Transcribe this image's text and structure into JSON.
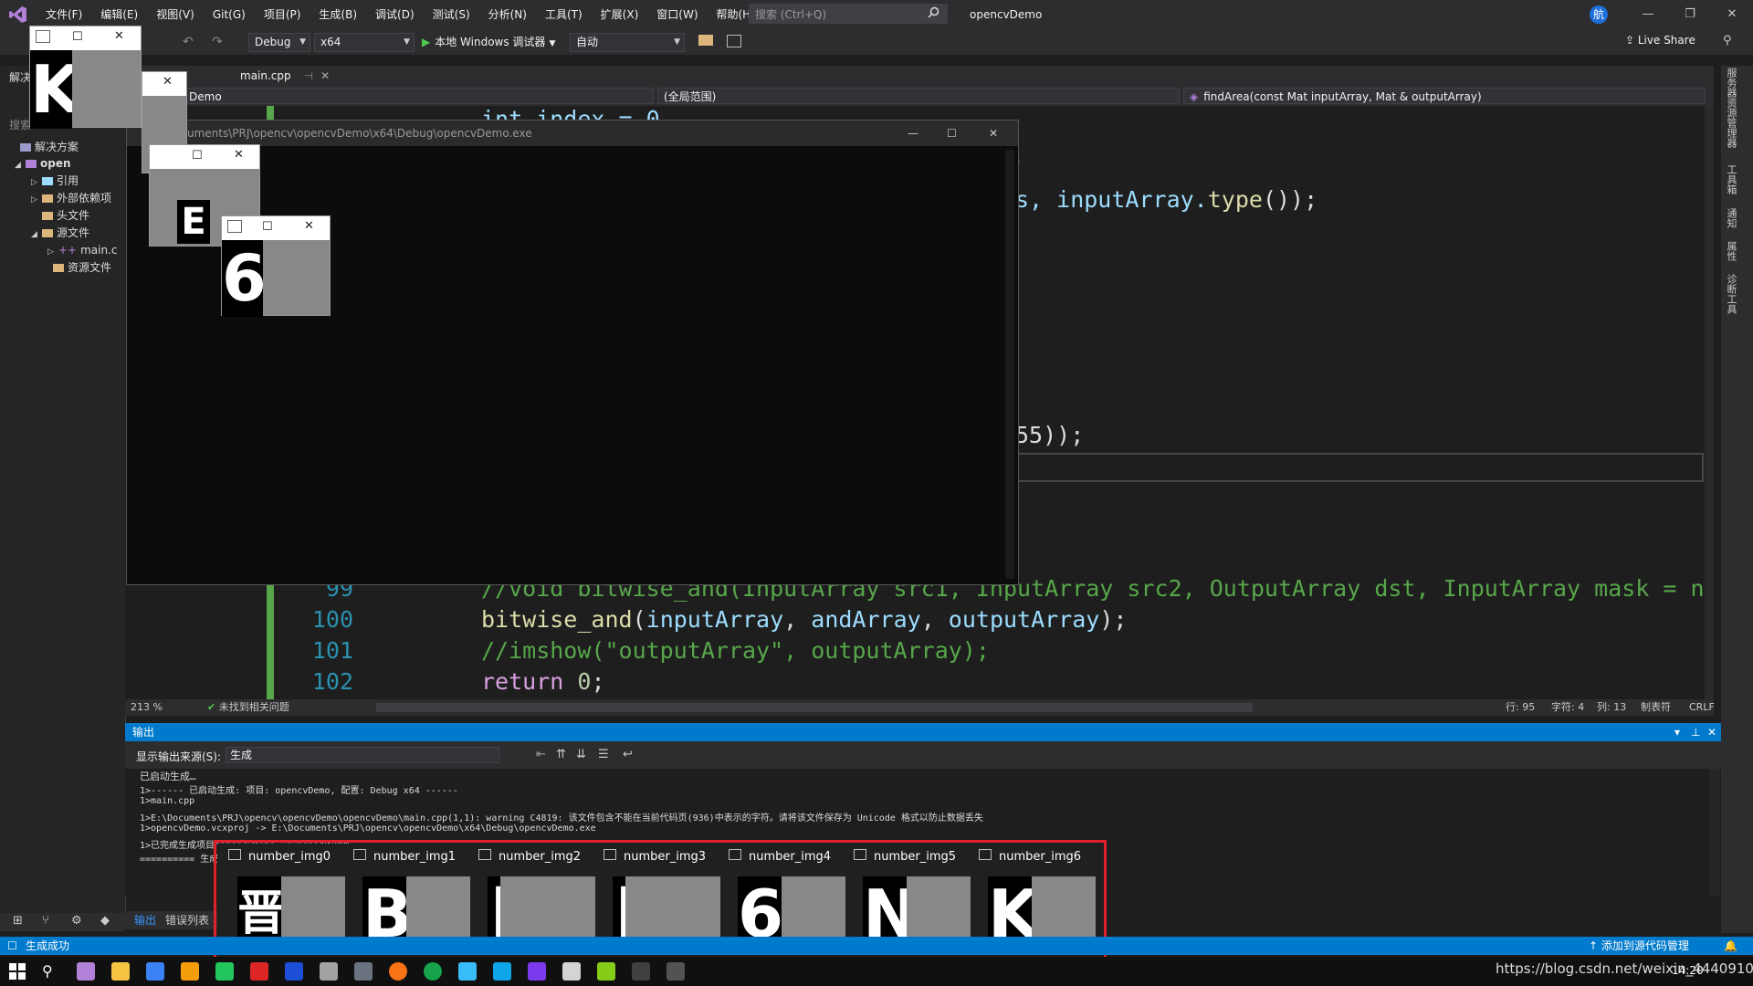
{
  "menu": {
    "items": [
      "文件(F)",
      "编辑(E)",
      "视图(V)",
      "Git(G)",
      "项目(P)",
      "生成(B)",
      "调试(D)",
      "测试(S)",
      "分析(N)",
      "工具(T)",
      "扩展(X)",
      "窗口(W)",
      "帮助(H)"
    ],
    "search_placeholder": "搜索 (Ctrl+Q)",
    "solution_name": "opencvDemo",
    "account_initial": "航"
  },
  "toolbar": {
    "config": "Debug",
    "platform": "x64",
    "run_label": "本地 Windows 调试器",
    "auto": "自动",
    "live_share": "Live Share"
  },
  "solution_explorer": {
    "title": "解决",
    "search": "搜索",
    "items": [
      {
        "label": "解决方案"
      },
      {
        "label": "open"
      },
      {
        "label": "引用"
      },
      {
        "label": "外部依赖项"
      },
      {
        "label": "头文件"
      },
      {
        "label": "源文件"
      },
      {
        "label": "main.c"
      },
      {
        "label": "资源文件"
      }
    ]
  },
  "editor": {
    "tab": "main.cpp",
    "project_scope": "Demo",
    "scope": "(全局范围)",
    "function_scope": "findArea(const Mat inputArray, Mat & outputArray)",
    "fragments": {
      "top_partial": "int index = 0",
      "semicolon": ";",
      "type_line_prefix": "s, inputArray.",
      "type_fn": "type",
      "type_line_suffix": "());",
      "num_line": "55));"
    },
    "lines": [
      {
        "no": "99",
        "comment": "//void bitwise_and(InputArray src1, InputArray src2, OutputArray dst, InputArray mask = noArray());"
      },
      {
        "no": "100",
        "fn": "bitwise_and",
        "args1": "inputArray",
        "args2": "andArray",
        "args3": "outputArray"
      },
      {
        "no": "101",
        "comment": "//imshow(\"outputArray\", outputArray);"
      },
      {
        "no": "102",
        "kw": "return",
        "num": "0"
      }
    ],
    "zoom": "213 %",
    "issues": "未找到相关问题",
    "row": "行: 95",
    "char": "字符: 4",
    "col": "列: 13",
    "tab_mode": "制表符",
    "eol": "CRLF"
  },
  "console": {
    "title": "uments\\PRJ\\opencv\\opencvDemo\\x64\\Debug\\opencvDemo.exe"
  },
  "image_windows": [
    {
      "glyph": "K"
    },
    {
      "glyph": "E"
    },
    {
      "glyph": "6"
    }
  ],
  "output": {
    "title": "输出",
    "source_label": "显示输出来源(S):",
    "source_value": "生成",
    "lines": [
      "已启动生成…",
      "1>------ 已启动生成: 项目: opencvDemo, 配置: Debug x64 ------",
      "1>main.cpp",
      "1>E:\\Documents\\PRJ\\opencv\\opencvDemo\\opencvDemo\\main.cpp(1,1): warning C4819: 该文件包含不能在当前代码页(936)中表示的字符。请将该文件保存为 Unicode 格式以防止数据丢失",
      "1>opencvDemo.vcxproj -> E:\\Documents\\PRJ\\opencv\\opencvDemo\\x64\\Debug\\opencvDemo.exe",
      "1>已完成生成项目\"opencvDemo.vcxproj\"的操作。",
      "========== 生成"
    ],
    "tabs": [
      "输出",
      "错误列表"
    ]
  },
  "thumbnails": [
    {
      "title": "number_img0",
      "glyph": "晋"
    },
    {
      "title": "number_img1",
      "glyph": "B"
    },
    {
      "title": "number_img2",
      "glyph": "|"
    },
    {
      "title": "number_img3",
      "glyph": "|"
    },
    {
      "title": "number_img4",
      "glyph": "6"
    },
    {
      "title": "number_img5",
      "glyph": "N"
    },
    {
      "title": "number_img6",
      "glyph": "K"
    }
  ],
  "status": {
    "left": "生成成功",
    "source_control": "添加到源代码管理"
  },
  "taskbar": {
    "time": "14:20",
    "watermark": "https://blog.csdn.net/weixin_44409103"
  },
  "right_strip": [
    "服务器资源管理器",
    "工具箱",
    "通知",
    "属性",
    "诊断工具"
  ],
  "colors": {
    "accent": "#007acc",
    "highlight": "#e0202a"
  }
}
